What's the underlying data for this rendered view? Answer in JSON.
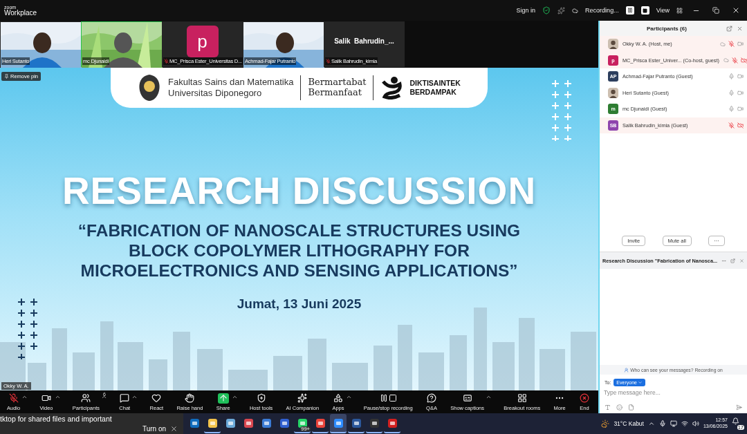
{
  "window": {
    "brand_top": "zoom",
    "brand": "Workplace",
    "sign_in": "Sign in",
    "recording": "Recording...",
    "view": "View"
  },
  "video_strip": [
    {
      "kind": "video",
      "name": "Heri Sutanto",
      "muted": false,
      "speaking": false
    },
    {
      "kind": "video",
      "name": "mc Djunaidi",
      "muted": false,
      "speaking": true
    },
    {
      "kind": "avatar",
      "name": "MC_Prisca Ester_Universitas D...",
      "letter": "p",
      "color": "#c8215f",
      "muted": true,
      "speaking": false
    },
    {
      "kind": "video",
      "name": "Achmad-Fajar Putranto",
      "muted": false,
      "speaking": false
    },
    {
      "kind": "name",
      "name": "Salik Bahrudin_kimia",
      "display_name": "Salik  Bahrudin_...",
      "muted": true,
      "speaking": false
    }
  ],
  "stage": {
    "remove_pin": "Remove pin",
    "speaker": "Okky W. A."
  },
  "slide": {
    "org": [
      "Fakultas Sains dan Matematika",
      "Universitas Diponegoro"
    ],
    "motto": [
      "Bermartabat",
      "Bermanfaat"
    ],
    "brand": [
      "DIKTISAINTEK",
      "BERDAMPAK"
    ],
    "title": "RESEARCH DISCUSSION",
    "subtitle": [
      "“FABRICATION OF NANOSCALE STRUCTURES USING",
      "BLOCK COPOLYMER LITHOGRAPHY FOR",
      "MICROELECTRONICS AND SENSING APPLICATIONS”"
    ],
    "date": "Jumat, 13 Juni 2025"
  },
  "toolbar": [
    {
      "label": "Audio",
      "muted": true,
      "caret": true
    },
    {
      "label": "Video",
      "caret": true
    },
    {
      "label": "Participants",
      "count": "6",
      "caret": true
    },
    {
      "label": "Chat",
      "caret": true
    },
    {
      "label": "React"
    },
    {
      "label": "Raise hand"
    },
    {
      "label": "Share",
      "highlighted": true,
      "caret": true
    },
    {
      "label": "Host tools"
    },
    {
      "label": "AI Companion"
    },
    {
      "label": "Apps",
      "caret": true
    },
    {
      "label": "Pause/stop recording"
    },
    {
      "label": "Q&A"
    },
    {
      "label": "Show captions",
      "caret": true
    },
    {
      "label": "Breakout rooms"
    },
    {
      "label": "More"
    },
    {
      "label": "End",
      "danger": true
    }
  ],
  "participants": {
    "title": "Participants (6)",
    "items": [
      {
        "name": "Okky W. A. (Host, me)",
        "cloud": true,
        "mic_muted": true,
        "video_off": false
      },
      {
        "name": "MC_Prisca Ester_Univer... (Co-host, guest)",
        "avatar": {
          "kind": "letter",
          "text": "p",
          "color": "#c8215f"
        },
        "cloud": true,
        "mic_muted": true,
        "video_off": true
      },
      {
        "name": "Achmad-Fajar Putranto (Guest)",
        "avatar": {
          "kind": "letter",
          "text": "AP",
          "color": "#2d3f5e"
        },
        "cloud": false,
        "mic_muted": false,
        "video_off": false
      },
      {
        "name": "Heri Sutanto (Guest)",
        "cloud": false,
        "mic_muted": false,
        "video_off": false
      },
      {
        "name": "mc Djunaidi (Guest)",
        "avatar": {
          "kind": "letter",
          "text": "m",
          "color": "#2e7d32"
        },
        "cloud": false,
        "mic_muted": false,
        "video_off": false
      },
      {
        "name": "Salik Bahrudin_kimia (Guest)",
        "avatar": {
          "kind": "letter",
          "text": "SB",
          "color": "#8e44ad"
        },
        "cloud": false,
        "mic_muted": true,
        "video_off": true
      }
    ],
    "buttons": [
      "Invite",
      "Mute all",
      "···"
    ]
  },
  "chat": {
    "title": "Research Discussion \"Fabrication of Nanosca...",
    "notice": "Who can see your messages? Recording on",
    "to_label": "To:",
    "recipient": "Everyone",
    "placeholder": "Type message here..."
  },
  "taskbar": {
    "toast": "tktop for shared files and important",
    "toast_action": "Turn on",
    "apps": [
      {
        "running": false,
        "selected": false
      },
      {
        "running": true,
        "selected": false
      },
      {
        "running": false,
        "selected": false
      },
      {
        "running": false,
        "selected": false
      },
      {
        "running": false,
        "selected": false
      },
      {
        "running": false,
        "selected": false
      },
      {
        "running": true,
        "selected": false,
        "badge": "99+"
      },
      {
        "running": true,
        "selected": false
      },
      {
        "running": true,
        "selected": true
      },
      {
        "running": true,
        "selected": false
      },
      {
        "running": true,
        "selected": false
      },
      {
        "running": true,
        "selected": false
      }
    ],
    "weather": "31°C  Kabut",
    "time": "12:57",
    "date": "13/06/2025",
    "notifications": "17"
  }
}
